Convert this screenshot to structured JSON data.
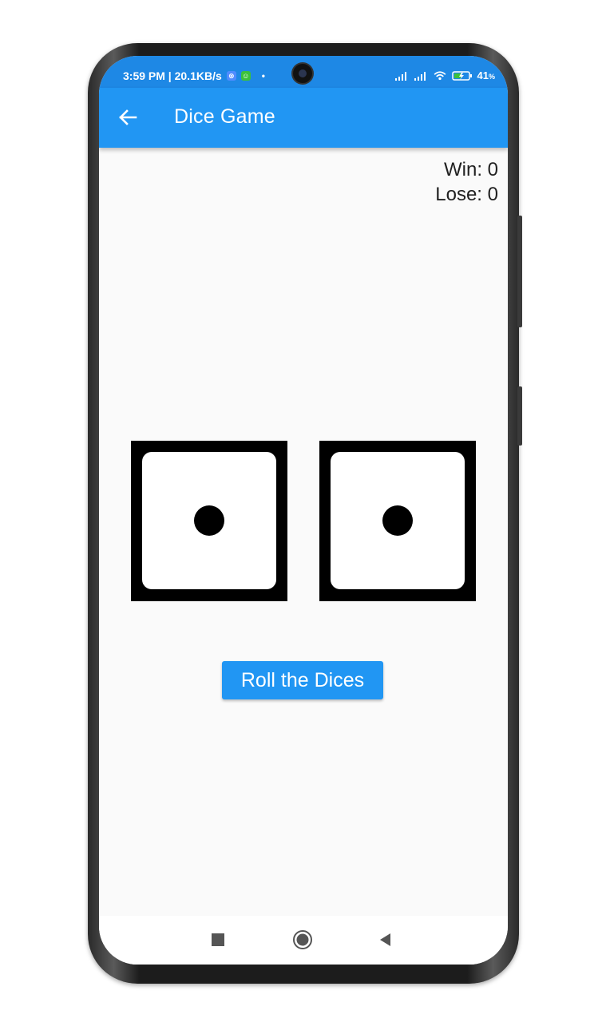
{
  "status_bar": {
    "time_speed": "3:59 PM | 20.1KB/s",
    "dot": "•",
    "battery_percent": "41",
    "battery_unit": "%"
  },
  "app_bar": {
    "title": "Dice Game",
    "back_icon": "arrow-left-icon"
  },
  "score": {
    "win_label": "Win: 0",
    "lose_label": "Lose: 0"
  },
  "dice": [
    {
      "value": 1
    },
    {
      "value": 1
    }
  ],
  "roll_button": {
    "label": "Roll the Dices"
  },
  "nav_bar": {
    "recents_icon": "square-icon",
    "home_icon": "circle-icon",
    "back_icon": "triangle-back-icon"
  },
  "colors": {
    "app_bar": "#2196f3",
    "status_bar": "#1e88e5",
    "button": "#2196f3",
    "background": "#fafafa"
  }
}
